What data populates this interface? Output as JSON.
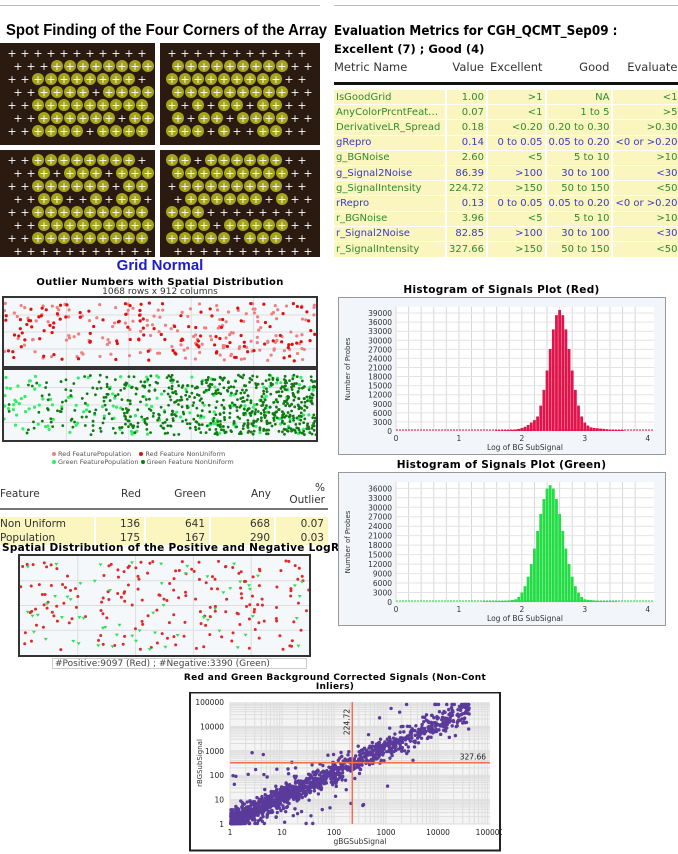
{
  "spot_finding": {
    "title": "Spot Finding of the Four Corners of the Array",
    "status": "Grid Normal"
  },
  "outliers": {
    "title": "Outlier Numbers with Spatial Distribution",
    "subtitle": "1068 rows x 912 columns",
    "legend": [
      "Red FeaturePopulation",
      "Red Feature NonUniform",
      "Green FeaturePopulation",
      "Green Feature NonUniform"
    ],
    "colors": {
      "red_pop": "#f08080",
      "red_nonuni": "#e01010",
      "green_pop": "#33ee66",
      "green_nonuni": "#127a12"
    },
    "table": {
      "headers": [
        "Feature",
        "Red",
        "Green",
        "Any",
        "% Outlier"
      ],
      "rows": [
        [
          "Non Uniform",
          "136",
          "641",
          "668",
          "0.07"
        ],
        [
          "Population",
          "175",
          "167",
          "290",
          "0.03"
        ]
      ]
    }
  },
  "logratios": {
    "title": "Spatial Distribution of the Positive and Negative LogRatios",
    "caption": "#Positive:9097 (Red) ; #Negative:3390 (Green)"
  },
  "metrics": {
    "title": "Evaluation Metrics for CGH_QCMT_Sep09 :",
    "summary": "Excellent (7) ; Good (4)",
    "headers": [
      "Metric Name",
      "Value",
      "Excellent",
      "Good",
      "Evaluate"
    ],
    "rows": [
      {
        "name": "IsGoodGrid",
        "value": "1.00",
        "excellent": ">1",
        "good": "NA",
        "evaluate": "<1",
        "color": "#2e8b2e"
      },
      {
        "name": "AnyColorPrcntFeatNonUn...",
        "value": "0.07",
        "excellent": "<1",
        "good": "1 to 5",
        "evaluate": ">5",
        "color": "#2e8b2e"
      },
      {
        "name": "DerivativeLR_Spread",
        "value": "0.18",
        "excellent": "<0.20",
        "good": "0.20 to 0.30",
        "evaluate": ">0.30",
        "color": "#2e8b2e"
      },
      {
        "name": "gRepro",
        "value": "0.14",
        "excellent": "0 to 0.05",
        "good": "0.05 to 0.20",
        "evaluate": "<0 or >0.20",
        "color": "#3a3ac8"
      },
      {
        "name": "g_BGNoise",
        "value": "2.60",
        "excellent": "<5",
        "good": "5 to 10",
        "evaluate": ">10",
        "color": "#2e8b2e"
      },
      {
        "name": "g_Signal2Noise",
        "value": "86.39",
        "excellent": ">100",
        "good": "30 to 100",
        "evaluate": "<30",
        "color": "#3a3ac8"
      },
      {
        "name": "g_SignalIntensity",
        "value": "224.72",
        "excellent": ">150",
        "good": "50 to 150",
        "evaluate": "<50",
        "color": "#2e8b2e"
      },
      {
        "name": "rRepro",
        "value": "0.13",
        "excellent": "0 to 0.05",
        "good": "0.05 to 0.20",
        "evaluate": "<0 or >0.20",
        "color": "#3a3ac8"
      },
      {
        "name": "r_BGNoise",
        "value": "3.96",
        "excellent": "<5",
        "good": "5 to 10",
        "evaluate": ">10",
        "color": "#2e8b2e"
      },
      {
        "name": "r_Signal2Noise",
        "value": "82.85",
        "excellent": ">100",
        "good": "30 to 100",
        "evaluate": "<30",
        "color": "#3a3ac8"
      },
      {
        "name": "r_SignalIntensity",
        "value": "327.66",
        "excellent": ">150",
        "good": "50 to 150",
        "evaluate": "<50",
        "color": "#2e8b2e"
      }
    ]
  },
  "chart_data": [
    {
      "type": "bar",
      "title": "Histogram of Signals Plot (Red)",
      "xlabel": "Log of BG SubSignal",
      "ylabel": "Number of Probes",
      "xlim": [
        0,
        4.1
      ],
      "ylim": [
        0,
        41000
      ],
      "xticks": [
        "0",
        "1",
        "2",
        "3",
        "4"
      ],
      "yticks": [
        "0",
        "3000",
        "6000",
        "9000",
        "12000",
        "15000",
        "18000",
        "21000",
        "24000",
        "27000",
        "30000",
        "33000",
        "36000",
        "39000"
      ],
      "grid": true,
      "color": "#e0144a",
      "x_start": 1.6,
      "bin_width": 0.05,
      "values": [
        150,
        150,
        200,
        250,
        300,
        400,
        500,
        700,
        1000,
        1400,
        2000,
        2800,
        3600,
        4800,
        8400,
        13600,
        20000,
        27100,
        33600,
        38300,
        40000,
        38300,
        33600,
        27100,
        20000,
        13600,
        8400,
        4800,
        2800,
        1800,
        1200,
        1000,
        900,
        800,
        700,
        600,
        500,
        400,
        350,
        300,
        250
      ]
    },
    {
      "type": "bar",
      "title": "Histogram of Signals Plot (Green)",
      "xlabel": "Log of BG SubSignal",
      "ylabel": "Number of Probes",
      "xlim": [
        0,
        4.1
      ],
      "ylim": [
        0,
        38000
      ],
      "xticks": [
        "0",
        "1",
        "2",
        "3",
        "4"
      ],
      "yticks": [
        "0",
        "3000",
        "6000",
        "9000",
        "12000",
        "15000",
        "18000",
        "21000",
        "24000",
        "27000",
        "30000",
        "33000",
        "36000"
      ],
      "grid": true,
      "color": "#22dd44",
      "x_start": 1.4,
      "bin_width": 0.05,
      "values": [
        150,
        150,
        200,
        200,
        250,
        300,
        350,
        400,
        500,
        650,
        850,
        1600,
        3000,
        5000,
        8000,
        12000,
        16900,
        22500,
        27900,
        32600,
        35900,
        37000,
        35900,
        32600,
        27900,
        22500,
        16900,
        12000,
        8000,
        5000,
        3000,
        1600,
        850,
        700,
        600,
        500,
        400,
        300,
        250,
        200,
        200,
        150,
        150
      ]
    },
    {
      "type": "scatter",
      "title": "Red and Green Background Corrected Signals (Non-Cont",
      "subtitle": "Inliers)",
      "xlabel": "gBGSubSignal",
      "ylabel": "rBGSubSignal",
      "xscale": "log",
      "yscale": "log",
      "xlim": [
        1,
        100000
      ],
      "ylim": [
        1,
        100000
      ],
      "xticks": [
        "1",
        "10",
        "100",
        "1000",
        "10000",
        "100000"
      ],
      "yticks": [
        "1",
        "10",
        "100",
        "1000",
        "10000",
        "100000"
      ],
      "grid": true,
      "color": "#5a3a9a",
      "ref_lines": {
        "x": 224.72,
        "y": 327.66,
        "x_label": "224.72",
        "y_label": "327.66",
        "color": "#f07050"
      }
    }
  ]
}
